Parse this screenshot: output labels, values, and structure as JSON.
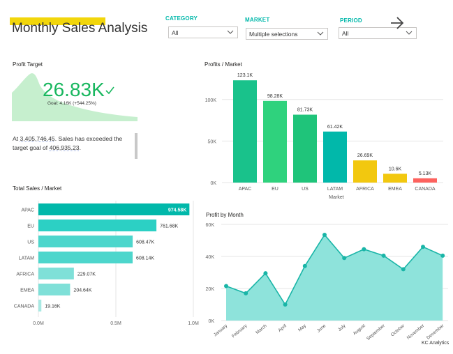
{
  "header": {
    "title": "Monthly Sales Analysis"
  },
  "slicers": {
    "category": {
      "label": "CATEGORY",
      "value": "All"
    },
    "market": {
      "label": "MARKET",
      "value": "Multiple selections"
    },
    "period": {
      "label": "PERIOD",
      "value": "All"
    }
  },
  "kpi": {
    "title": "Profit Target",
    "value": "26.83K",
    "goal": "Goal: 4.16K (+544.25%)",
    "text_prefix": "At ",
    "text_amount": "3,405,746.45",
    "text_middle": ". Sales has exceeded the target goal of ",
    "text_goal": "406,935.23",
    "text_end": "."
  },
  "footer": "KC Analytics",
  "colors": {
    "accent": "#01b8aa",
    "yellow": "#f2c80f",
    "red": "#fd625e",
    "green": "#19b75f"
  },
  "chart_data": [
    {
      "id": "profits_market",
      "type": "bar",
      "title": "Profits / Market",
      "xlabel": "Market",
      "ylabel": "",
      "categories": [
        "APAC",
        "EU",
        "US",
        "LATAM",
        "AFRICA",
        "EMEA",
        "CANADA"
      ],
      "values": [
        123100,
        98280,
        81730,
        61420,
        26690,
        10600,
        5130
      ],
      "labels": [
        "123.1K",
        "98.28K",
        "81.73K",
        "61.42K",
        "26.69K",
        "10.6K",
        "5.13K"
      ],
      "colors": [
        "#19c28b",
        "#2fd27d",
        "#1fc47a",
        "#01b8aa",
        "#f2c80f",
        "#f2c80f",
        "#fd625e"
      ],
      "yticks": [
        0,
        50000,
        100000
      ],
      "ytick_labels": [
        "0K",
        "50K",
        "100K"
      ],
      "ylim": [
        0,
        130000
      ]
    },
    {
      "id": "total_sales_market",
      "type": "bar",
      "orientation": "horizontal",
      "title": "Total Sales / Market",
      "categories": [
        "APAC",
        "EU",
        "US",
        "LATAM",
        "AFRICA",
        "EMEA",
        "CANADA"
      ],
      "values": [
        974580,
        761680,
        608470,
        608140,
        229070,
        204640,
        19160
      ],
      "labels": [
        "974.58K",
        "761.68K",
        "608.47K",
        "608.14K",
        "229.07K",
        "204.64K",
        "19.16K"
      ],
      "colors": [
        "#01b8aa",
        "#2cd0c4",
        "#4dd6cc",
        "#4dd6cc",
        "#7fe0d8",
        "#7fe0d8",
        "#a8e9e3"
      ],
      "xticks": [
        0,
        500000,
        1000000
      ],
      "xtick_labels": [
        "0.0M",
        "0.5M",
        "1.0M"
      ],
      "xlim": [
        0,
        1000000
      ]
    },
    {
      "id": "profit_by_month",
      "type": "area",
      "title": "Profit by Month",
      "categories": [
        "January",
        "February",
        "March",
        "April",
        "May",
        "June",
        "July",
        "August",
        "September",
        "October",
        "November",
        "December"
      ],
      "values": [
        21500,
        17000,
        29500,
        10000,
        34000,
        53500,
        39000,
        44500,
        40500,
        32000,
        46000,
        40500
      ],
      "yticks": [
        0,
        20000,
        40000,
        60000
      ],
      "ytick_labels": [
        "0K",
        "20K",
        "40K",
        "60K"
      ],
      "ylim": [
        0,
        60000
      ],
      "line_color": "#19b5a7",
      "fill_color": "#8ee3db"
    }
  ]
}
